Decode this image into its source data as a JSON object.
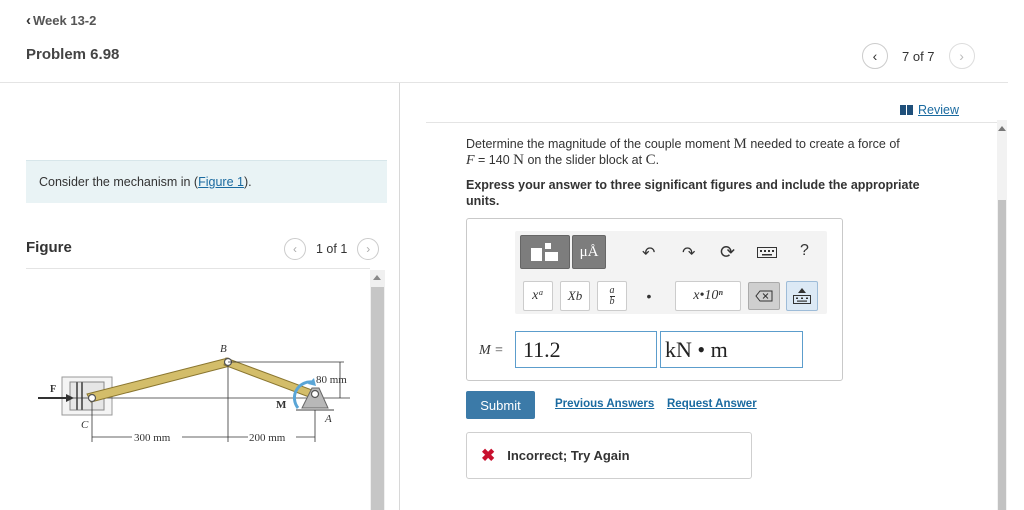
{
  "header": {
    "back_label": "Week 13-2",
    "problem_title": "Problem 6.98",
    "pager_text": "7 of 7"
  },
  "left": {
    "consider_prefix": "Consider the mechanism in (",
    "consider_link": "Figure 1",
    "consider_suffix": ").",
    "figure_label": "Figure",
    "figure_pager": "1 of 1",
    "figure_labels": {
      "b": "B",
      "f": "F",
      "c": "C",
      "m": "M",
      "a": "A",
      "dim_80": "80 mm",
      "dim_300": "300 mm",
      "dim_200": "200 mm"
    }
  },
  "right": {
    "review_label": "Review",
    "prompt_1": "Determine the magnitude of the couple moment ",
    "prompt_m": "M",
    "prompt_2": " needed to create a force of",
    "prompt_f": "F",
    "prompt_3": " = 140 ",
    "prompt_n": "N",
    "prompt_4": " on the slider block at ",
    "prompt_c": "C",
    "prompt_5": ".",
    "instruction": "Express your answer to three significant figures and include the appropriate units.",
    "toolbar": {
      "units_label": "μÅ",
      "help_label": "?",
      "superscript_label": "xᵃ",
      "subscript_label": "Xb",
      "fraction_top": "a",
      "fraction_bottom": "b",
      "dot_label": "•",
      "sci_label": "x•10ⁿ",
      "icons": [
        "templates-icon",
        "units-icon",
        "undo-icon",
        "redo-icon",
        "reset-icon",
        "keyboard-icon",
        "help-icon",
        "delete-icon",
        "keyboard-toggle-icon"
      ]
    },
    "m_label": "M =",
    "m_value": "11.2",
    "unit_value": "kN • m",
    "submit_label": "Submit",
    "previous_answers": "Previous Answers",
    "request_answer": "Request Answer",
    "feedback": "Incorrect; Try Again"
  },
  "colors": {
    "link": "#1a6aa0",
    "submit": "#3b7aa8",
    "error": "#c8102e",
    "input_border": "#5c9dcc",
    "consider_bg": "#e9f3f5"
  }
}
